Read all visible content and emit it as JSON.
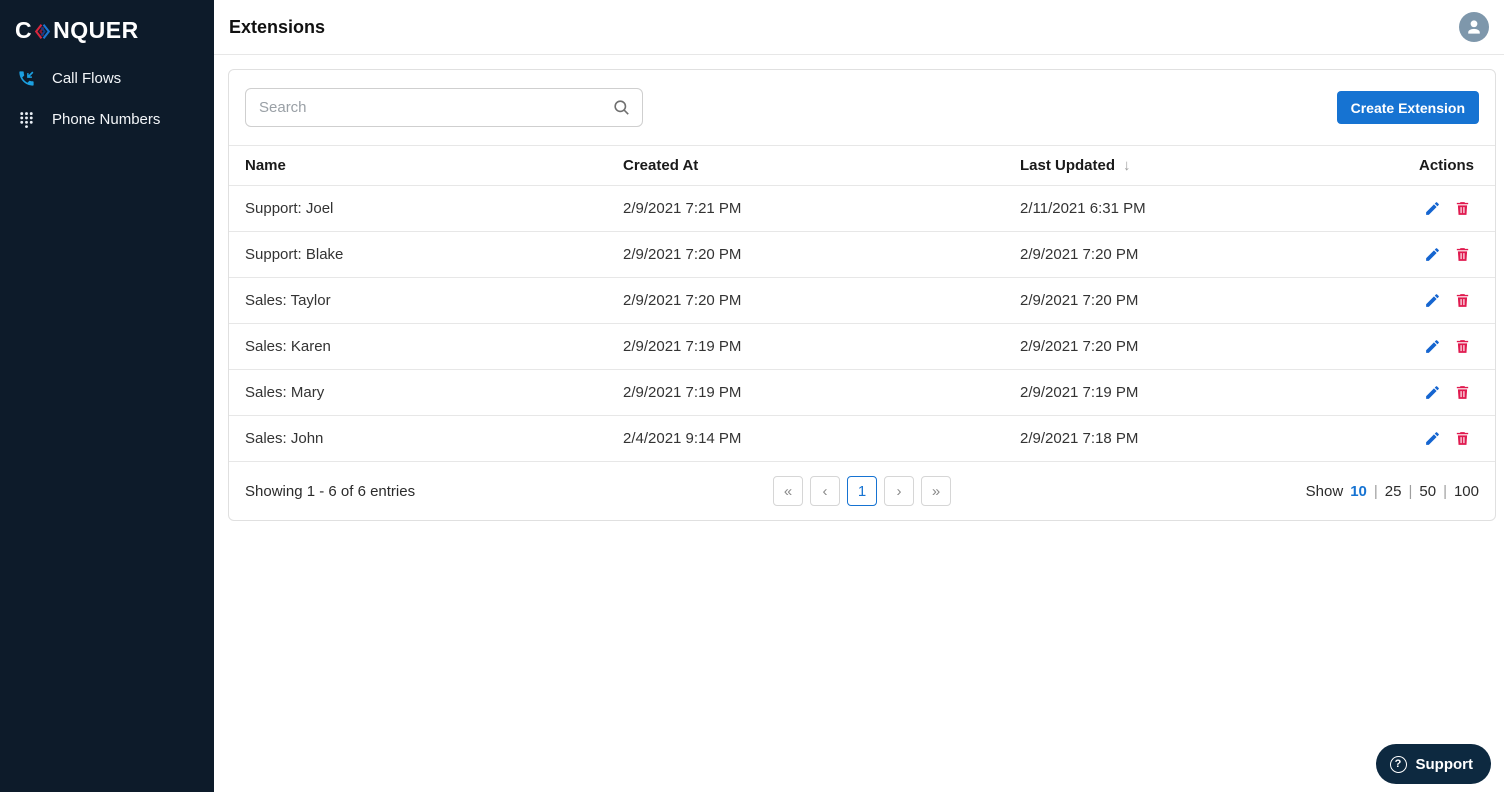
{
  "brand": {
    "name_left": "C",
    "name_right": "NQUER"
  },
  "sidebar": {
    "items": [
      {
        "label": "Call Flows"
      },
      {
        "label": "Phone Numbers"
      }
    ]
  },
  "header": {
    "title": "Extensions"
  },
  "toolbar": {
    "search_placeholder": "Search",
    "search_value": "",
    "create_button": "Create Extension"
  },
  "table": {
    "columns": {
      "name": "Name",
      "created_at": "Created At",
      "last_updated": "Last Updated",
      "actions": "Actions"
    },
    "sort_indicator": "↓",
    "rows": [
      {
        "name": "Support: Joel",
        "created_at": "2/9/2021 7:21 PM",
        "last_updated": "2/11/2021 6:31 PM"
      },
      {
        "name": "Support: Blake",
        "created_at": "2/9/2021 7:20 PM",
        "last_updated": "2/9/2021 7:20 PM"
      },
      {
        "name": "Sales: Taylor",
        "created_at": "2/9/2021 7:20 PM",
        "last_updated": "2/9/2021 7:20 PM"
      },
      {
        "name": "Sales: Karen",
        "created_at": "2/9/2021 7:19 PM",
        "last_updated": "2/9/2021 7:20 PM"
      },
      {
        "name": "Sales: Mary",
        "created_at": "2/9/2021 7:19 PM",
        "last_updated": "2/9/2021 7:19 PM"
      },
      {
        "name": "Sales: John",
        "created_at": "2/4/2021 9:14 PM",
        "last_updated": "2/9/2021 7:18 PM"
      }
    ]
  },
  "footer": {
    "showing_text": "Showing 1 - 6 of 6 entries",
    "pagination": {
      "first": "«",
      "prev": "‹",
      "current_page": "1",
      "next": "›",
      "last": "»"
    },
    "page_size": {
      "label": "Show",
      "separator": "|",
      "options": [
        "10",
        "25",
        "50",
        "100"
      ],
      "selected": "10"
    }
  },
  "support_button": {
    "label": "Support",
    "icon_glyph": "?"
  },
  "colors": {
    "sidebar_bg": "#0d1b2a",
    "primary_blue": "#1673d2",
    "edit_blue": "#1565d0",
    "danger_red": "#e01a4f",
    "avatar_bg": "#7e97ab",
    "support_bg": "#0d2940",
    "logo_red": "#d7263d",
    "logo_blue": "#1b75d1",
    "phone_icon_blue": "#1ba0e1"
  }
}
